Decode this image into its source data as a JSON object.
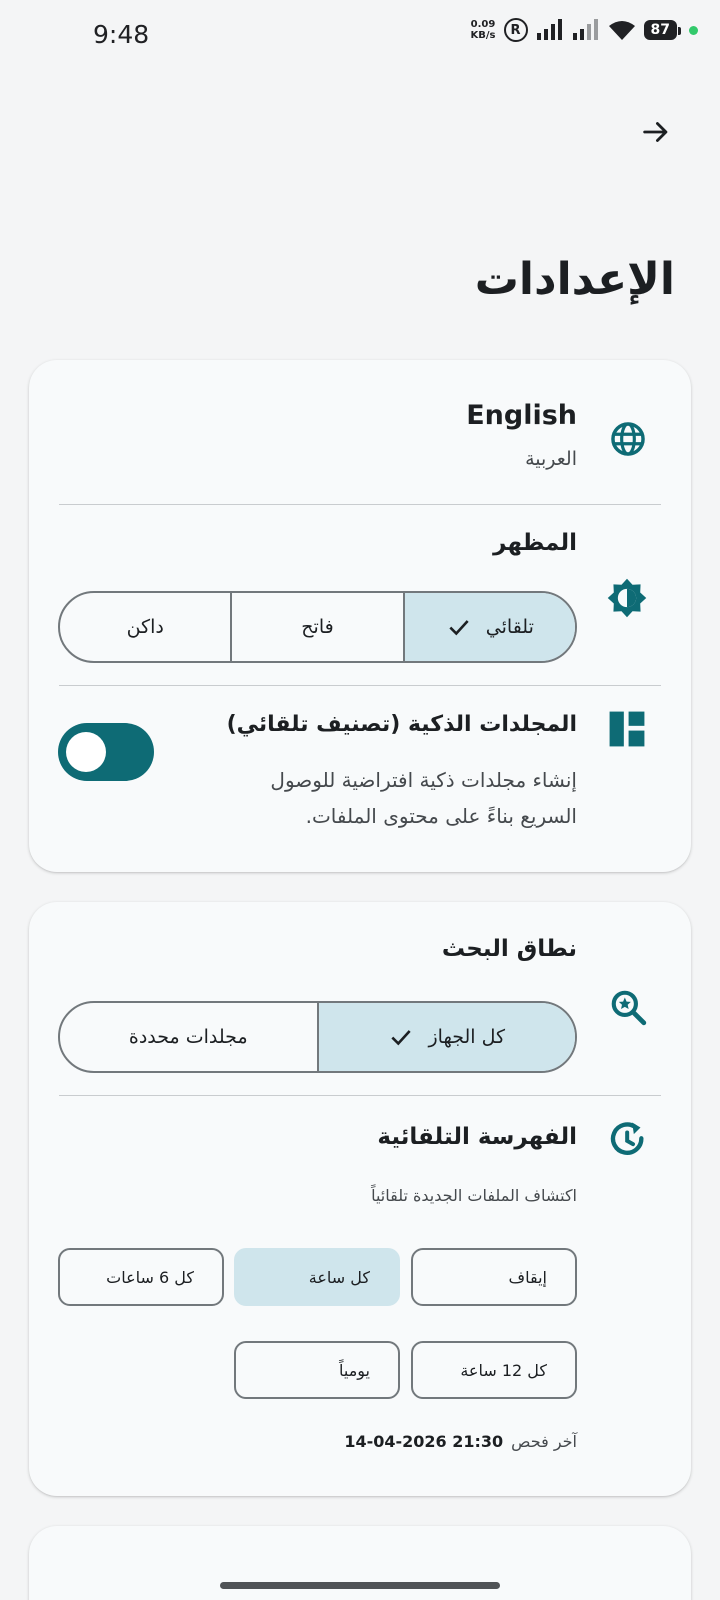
{
  "status_bar": {
    "time": "9:48",
    "net_speed_value": "0.09",
    "net_speed_unit": "KB/s",
    "registered_mark": "R",
    "battery": "87"
  },
  "header": {
    "title": "الإعدادات"
  },
  "colors": {
    "accent": "#0e6b75",
    "selected_fill": "#cfe5ec",
    "card_bg": "#f8fafb"
  },
  "language": {
    "title": "English",
    "subtitle": "العربية"
  },
  "appearance": {
    "title": "المظهر",
    "options": [
      "تلقائي",
      "فاتح",
      "داكن"
    ],
    "selected": "تلقائي"
  },
  "smart_folders": {
    "title": "المجلدات الذكية (تصنيف تلقائي)",
    "description_line1": "إنشاء مجلدات ذكية افتراضية للوصول",
    "description_line2": "السريع بناءً على محتوى الملفات.",
    "enabled": false
  },
  "search_scope": {
    "title": "نطاق البحث",
    "options": [
      "كل الجهاز",
      "مجلدات محددة"
    ],
    "selected": "كل الجهاز"
  },
  "auto_indexing": {
    "title": "الفهرسة التلقائية",
    "description": "اكتشاف الملفات الجديدة تلقائياً",
    "options": [
      "إيقاف",
      "كل ساعة",
      "كل 6 ساعات",
      "كل 12 ساعة",
      "يومياً"
    ],
    "selected": "كل ساعة",
    "last_scan_label": "آخر فحص",
    "last_scan_value": "14-04-2026 21:30"
  }
}
